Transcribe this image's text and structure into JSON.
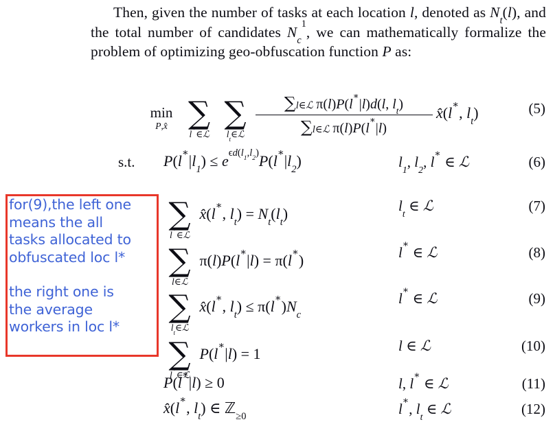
{
  "document": {
    "paragraph": {
      "segments": [
        {
          "t": "Then, given the number of tasks at each location ",
          "k": "text"
        },
        {
          "t": "l",
          "k": "it"
        },
        {
          "t": ", denoted as ",
          "k": "text"
        },
        {
          "t": "N",
          "k": "it"
        },
        {
          "t": "t",
          "k": "sub"
        },
        {
          "t": "(",
          "k": "text"
        },
        {
          "t": "l",
          "k": "it"
        },
        {
          "t": "), and the total number of candidates ",
          "k": "text"
        },
        {
          "t": "N",
          "k": "it"
        },
        {
          "t": "c",
          "k": "sub"
        },
        {
          "t": "1",
          "k": "sup"
        },
        {
          "t": ", we can mathematically formalize the problem of optimizing geo-obfuscation function ",
          "k": "text"
        },
        {
          "t": "P",
          "k": "it"
        },
        {
          "t": " as:",
          "k": "text"
        }
      ],
      "plain": "Then, given the number of tasks at each location l, denoted as N_t(l), and the total number of candidates N_c^1, we can mathematically formalize the problem of optimizing geo-obfuscation function P as:"
    },
    "subject_to_label": "s.t.",
    "equations": [
      {
        "number": "(5)",
        "objective_operator": "min",
        "objective_subscript": "P, x̂",
        "sum1_limits": "l* ∈ L",
        "sum2_limits": "l_t ∈ L",
        "fraction_numerator": "Σ_{l∈L} π(l)P(l*|l)d(l, l_t)",
        "fraction_denominator": "Σ_{l∈L} π(l)P(l*|l)",
        "trailing": "x̂(l*, l_t)",
        "domain": "",
        "lhs_plain": "min_{P,x̂} Σ_{l*∈L} Σ_{l_t∈L} [Σ_{l∈L} π(l)P(l*|l)d(l,l_t)] / [Σ_{l∈L} π(l)P(l*|l)] · x̂(l*, l_t)"
      },
      {
        "number": "(6)",
        "lhs_plain": "P(l*|l_1) ≤ e^{εd(l_1,l_2)} P(l*|l_2)",
        "domain": "l_1, l_2, l* ∈ L"
      },
      {
        "number": "(7)",
        "sum_limits": "l* ∈ L",
        "lhs_plain": "Σ_{l*∈L} x̂(l*, l_t) = N_t(l_t)",
        "domain": "l_t ∈ L"
      },
      {
        "number": "(8)",
        "sum_limits": "l ∈ L",
        "lhs_plain": "Σ_{l∈L} π(l)P(l*|l) = π(l*)",
        "domain": "l* ∈ L"
      },
      {
        "number": "(9)",
        "sum_limits": "l_t ∈ L",
        "lhs_plain": "Σ_{l_t∈L} x̂(l*, l_t) ≤ π(l*)N_c",
        "domain": "l* ∈ L"
      },
      {
        "number": "(10)",
        "sum_limits": "l* ∈ L",
        "lhs_plain": "Σ_{l*∈L} P(l*|l) = 1",
        "domain": "l ∈ L"
      },
      {
        "number": "(11)",
        "lhs_plain": "P(l*|l) ≥ 0",
        "domain": "l, l* ∈ L"
      },
      {
        "number": "(12)",
        "lhs_plain": "x̂(l*, l_t) ∈ Z_{≥0}",
        "domain": "l*, l_t ∈ L"
      }
    ]
  },
  "annotation": {
    "box_color": "#e8372a",
    "text_color": "#3f63d6",
    "lines_block_1": [
      "for(9),the left one",
      "means the all",
      "tasks allocated to",
      "obfuscated loc l*"
    ],
    "lines_block_2": [
      "the right one is",
      "the average",
      "workers in loc l*"
    ],
    "full_text": "for(9),the left one means the all tasks allocated to obfuscated loc l*  the right one is the average workers in loc l*"
  }
}
